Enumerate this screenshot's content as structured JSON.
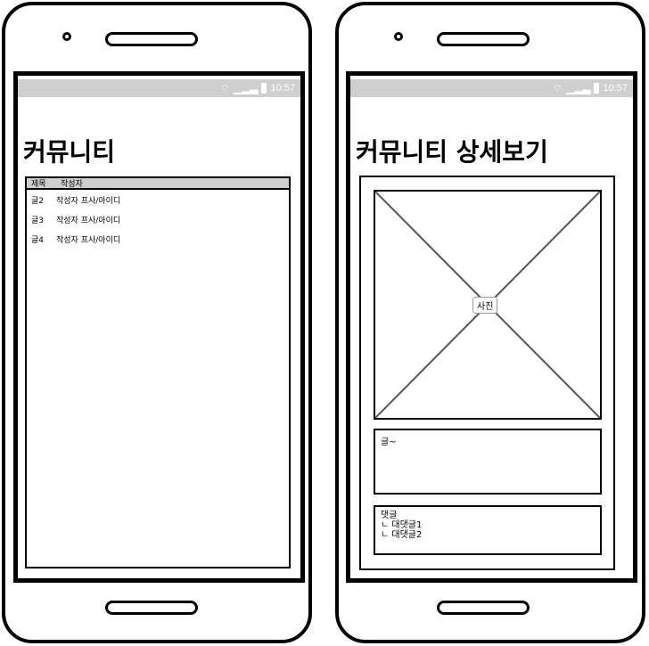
{
  "status_bar": {
    "time": "10:57",
    "icons": [
      "wifi-icon",
      "signal-icon",
      "battery-icon"
    ]
  },
  "left_screen": {
    "title": "커뮤니티",
    "list": {
      "header_title": "제목",
      "header_author": "작성자",
      "rows": [
        {
          "title": "글2",
          "author": "작성자 프사/아이디"
        },
        {
          "title": "글3",
          "author": "작성자 프사/아이디"
        },
        {
          "title": "글4",
          "author": "작성자 프사/아이디"
        }
      ]
    }
  },
  "right_screen": {
    "title": "커뮤니티 상세보기",
    "image_label": "사진",
    "content_text": "글~",
    "comment_title": "댓글",
    "replies": [
      "ㄴ 대댓글1",
      "ㄴ 대댓글2"
    ]
  },
  "colors": {
    "status_bar_bg": "#cfcfcf",
    "header_bg": "#cfcfcf",
    "stroke": "#000000"
  }
}
